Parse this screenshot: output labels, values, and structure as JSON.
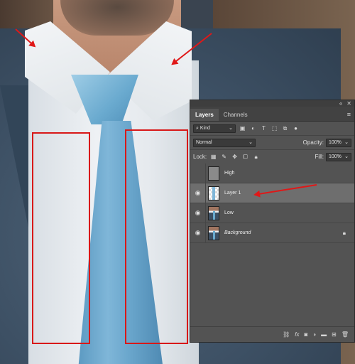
{
  "panel": {
    "tabs": [
      {
        "label": "Layers",
        "active": true
      },
      {
        "label": "Channels",
        "active": false
      }
    ],
    "filter": {
      "value": "Kind"
    },
    "blend_mode": {
      "value": "Normal"
    },
    "opacity": {
      "label": "Opacity:",
      "value": "100%"
    },
    "lock": {
      "label": "Lock:"
    },
    "fill": {
      "label": "Fill:",
      "value": "100%"
    },
    "layers": [
      {
        "name": "High",
        "visible": false,
        "thumb": "gray",
        "italic": false,
        "locked": false,
        "selected": false
      },
      {
        "name": "Layer 1",
        "visible": true,
        "thumb": "transparent",
        "italic": false,
        "locked": false,
        "selected": true
      },
      {
        "name": "Low",
        "visible": true,
        "thumb": "photo",
        "italic": false,
        "locked": false,
        "selected": false
      },
      {
        "name": "Background",
        "visible": true,
        "thumb": "photo",
        "italic": true,
        "locked": true,
        "selected": false
      }
    ],
    "bottom_icons": [
      "link-icon",
      "fx-icon",
      "mask-icon",
      "adjustment-icon",
      "folder-icon",
      "new-layer-icon",
      "trash-icon"
    ],
    "fx_label": "fx"
  },
  "colors": {
    "panel_bg": "#535353",
    "selected_layer": "#6e6e6e",
    "annotation_red": "#d81818"
  }
}
